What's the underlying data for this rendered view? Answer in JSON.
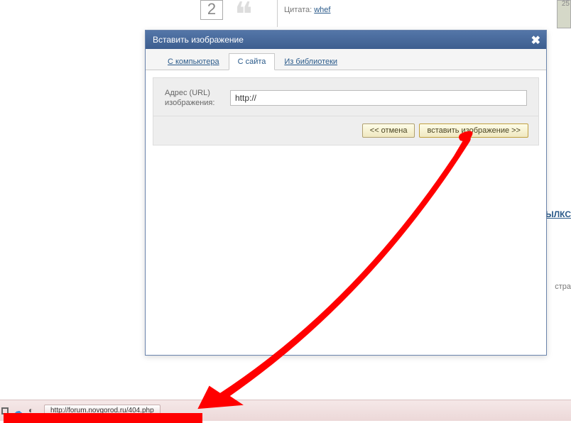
{
  "background": {
    "vote_number": "2",
    "cite_label": "Цитата:",
    "cite_author": "whef",
    "side_link": "ЫЛКС",
    "side_text": "стра",
    "thumb_date": "25"
  },
  "modal": {
    "title": "Вставить изображение",
    "close": "✖",
    "tabs": {
      "computer": "С компьютера",
      "site": "С сайта",
      "library": "Из библиотеки"
    },
    "form": {
      "url_label": "Адрес (URL) изображения:",
      "url_value": "http://"
    },
    "buttons": {
      "cancel": "<< отмена",
      "insert": "вставить изображение >>"
    }
  },
  "taskbar": {
    "item1": "http://forum.novgorod.ru/404.php"
  }
}
